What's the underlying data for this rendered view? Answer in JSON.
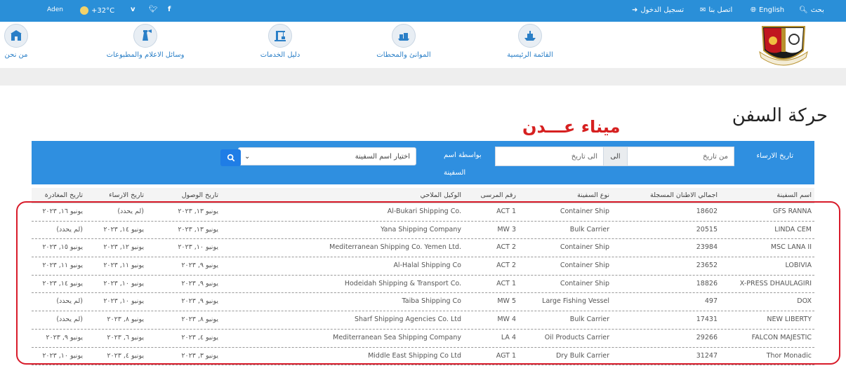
{
  "topbar": {
    "search": "بحث",
    "language": "English",
    "contact": "اتصل بنا",
    "login": "تسجيل الدخول",
    "city": "Aden",
    "temperature": "+32°C"
  },
  "nav": {
    "items": [
      {
        "label": "القائمة الرئيسية",
        "icon": "ship-icon"
      },
      {
        "label": "الموانئ والمحطات",
        "icon": "port-icon"
      },
      {
        "label": "دليل الخدمات",
        "icon": "crane-icon"
      },
      {
        "label": "وسائل الاعلام والمطبوعات",
        "icon": "lighthouse-icon"
      },
      {
        "label": "من نحن",
        "icon": "anchor-building-icon"
      }
    ]
  },
  "page": {
    "title": "حركة السفن",
    "annotation": "ميناء عـــدن"
  },
  "filter": {
    "anchor_date_label": "تاريخ الارساء",
    "from_placeholder": "من تاريخ",
    "to_addon": "الى",
    "to_placeholder": "الى تاريخ",
    "by_ship_name_label_1": "بواسطة اسم",
    "by_ship_name_label_2": "السفينة",
    "ship_select_value": "اختيار اسم السفينة"
  },
  "table": {
    "headers": [
      "اسم السفينة",
      "اجمالي الاطنان المسجلة",
      "نوع السفينة",
      "رقم المرسى",
      "الوكيل الملاحي",
      "تاريخ الوصول",
      "تاريخ الارساء",
      "تاريخ المغادرة"
    ],
    "rows": [
      {
        "name": "GFS RANNA",
        "tonnage": "18602",
        "type": "Container Ship",
        "berth": "ACT 1",
        "agent": "Al-Bukari Shipping Co.",
        "arrival": "يونيو ١٣, ٢٠٢٣",
        "berthing": "(لم يحدد)",
        "departure": "يونيو ١٦, ٢٠٢٣"
      },
      {
        "name": "LINDA CEM",
        "tonnage": "20515",
        "type": "Bulk Carrier",
        "berth": "MW 3",
        "agent": "Yana Shipping Company",
        "arrival": "يونيو ١٣, ٢٠٢٣",
        "berthing": "يونيو ١٤, ٢٠٢٣",
        "departure": "(لم يحدد)"
      },
      {
        "name": "MSC LANA II",
        "tonnage": "23984",
        "type": "Container Ship",
        "berth": "ACT 2",
        "agent": "Mediterranean Shipping Co. Yemen Ltd.",
        "arrival": "يونيو ١٠, ٢٠٢٣",
        "berthing": "يونيو ١٢, ٢٠٢٣",
        "departure": "يونيو ١٥, ٢٠٢٣"
      },
      {
        "name": "LOBIVIA",
        "tonnage": "23652",
        "type": "Container Ship",
        "berth": "ACT 2",
        "agent": "Al-Halal Shipping Co",
        "arrival": "يونيو ٩, ٢٠٢٣",
        "berthing": "يونيو ١١, ٢٠٢٣",
        "departure": "يونيو ١١, ٢٠٢٣"
      },
      {
        "name": "X-PRESS DHAULAGIRI",
        "tonnage": "18826",
        "type": "Container Ship",
        "berth": "ACT 1",
        "agent": "Hodeidah Shipping & Transport Co.",
        "arrival": "يونيو ٩, ٢٠٢٣",
        "berthing": "يونيو ١٠, ٢٠٢٣",
        "departure": "يونيو ١٤, ٢٠٢٣"
      },
      {
        "name": "DOX",
        "tonnage": "497",
        "type": "Large Fishing Vessel",
        "berth": "MW 5",
        "agent": "Taiba Shipping Co",
        "arrival": "يونيو ٩, ٢٠٢٣",
        "berthing": "يونيو ١٠, ٢٠٢٣",
        "departure": "(لم يحدد)"
      },
      {
        "name": "NEW LIBERTY",
        "tonnage": "17431",
        "type": "Bulk Carrier",
        "berth": "MW 4",
        "agent": "Sharf Shipping Agencies Co. Ltd",
        "arrival": "يونيو ٨, ٢٠٢٣",
        "berthing": "يونيو ٨, ٢٠٢٣",
        "departure": "(لم يحدد)"
      },
      {
        "name": "FALCON MAJESTIC",
        "tonnage": "29266",
        "type": "Oil Products Carrier",
        "berth": "LA 4",
        "agent": "Mediterranean Sea Shipping Company",
        "arrival": "يونيو ٤, ٢٠٢٣",
        "berthing": "يونيو ٦, ٢٠٢٣",
        "departure": "يونيو ٩, ٢٠٢٣"
      },
      {
        "name": "Thor Monadic",
        "tonnage": "31247",
        "type": "Dry Bulk Carrier",
        "berth": "AGT 1",
        "agent": "Middle East Shipping Co Ltd",
        "arrival": "يونيو ٣, ٢٠٢٣",
        "berthing": "يونيو ٤, ٢٠٢٣",
        "departure": "يونيو ١٠, ٢٠٢٣"
      }
    ]
  },
  "colors": {
    "topbar": "#2a8fd8",
    "filter_panel": "#2f8fe0",
    "annotation_red": "#d81b2a",
    "nav_link": "#2a7fc7"
  }
}
